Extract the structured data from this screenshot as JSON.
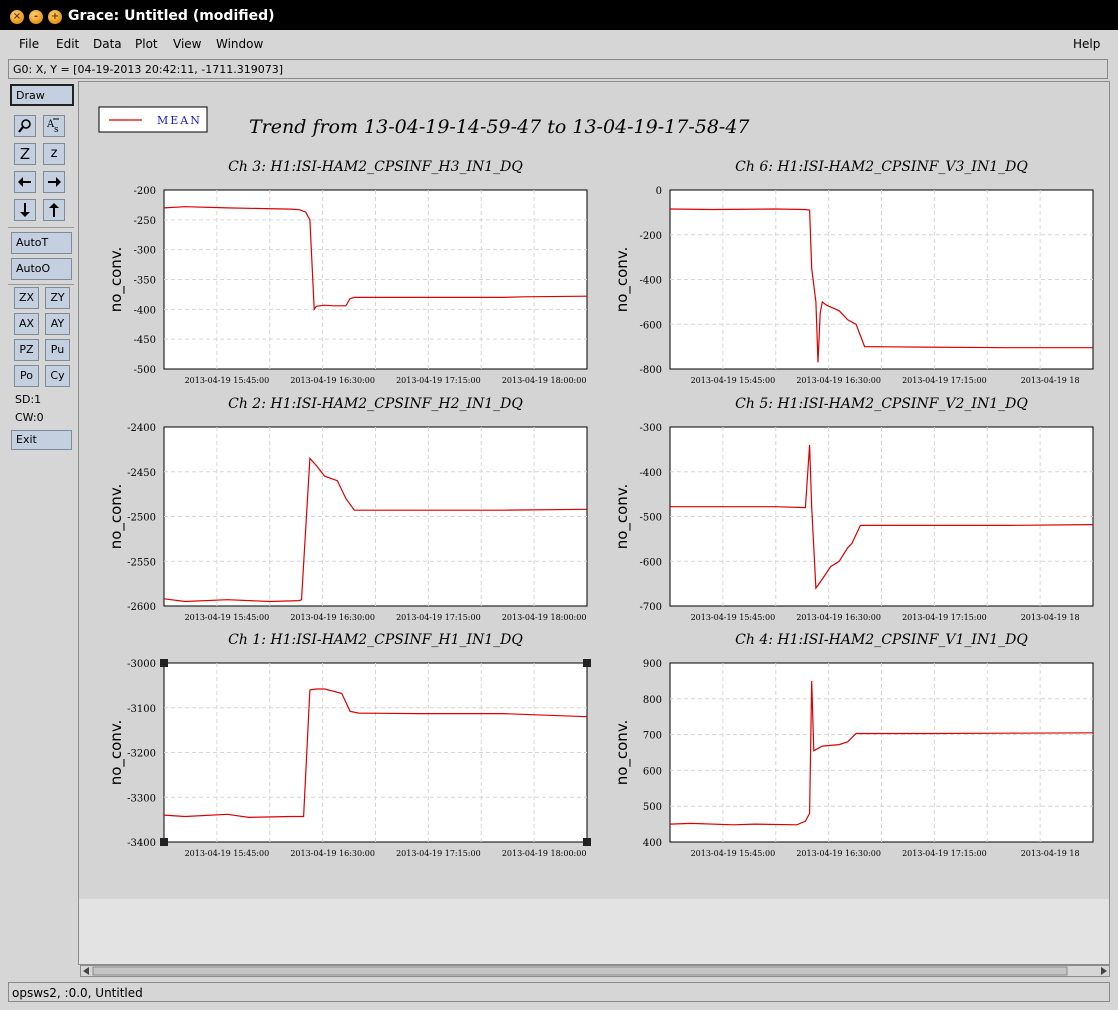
{
  "window": {
    "title": "Grace: Untitled (modified)",
    "buttons": [
      "close-icon",
      "minimize-icon",
      "maximize-icon"
    ]
  },
  "menubar": {
    "items": [
      "File",
      "Edit",
      "Data",
      "Plot",
      "View",
      "Window"
    ],
    "help": "Help"
  },
  "locator": "G0: X, Y = [04-19-2013 20:42:11, -1711.319073]",
  "toolbar": {
    "draw": "Draw",
    "icons": [
      "zoom-icon",
      "autoscale-text-icon",
      "zoom-in-icon",
      "zoom-out-icon",
      "left-arrow-icon",
      "right-arrow-icon",
      "down-arrow-icon",
      "up-arrow-icon"
    ],
    "zoom_in_label": "Z",
    "zoom_out_label": "z",
    "autoT": "AutoT",
    "autoO": "AutoO",
    "grid": [
      "ZX",
      "ZY",
      "AX",
      "AY",
      "PZ",
      "Pu",
      "Po",
      "Cy"
    ],
    "sd": "SD:1",
    "cw": "CW:0",
    "exit": "Exit"
  },
  "status": "opsws2, :0.0, Untitled",
  "chart_data": {
    "title": "Trend from 13-04-19-14-59-47 to 13-04-19-17-58-47",
    "legend": {
      "entries": [
        "MEAN"
      ],
      "placement": "top-left",
      "color": "#dd0000"
    },
    "line_color": "#dd0000",
    "grid": true,
    "panels": [
      {
        "title": "Ch 3: H1:ISI-HAM2_CPSINF_H3_IN1_DQ",
        "type": "line",
        "ylabel": "no_conv.",
        "ylim": [
          -500,
          -200
        ],
        "yticks": [
          -200,
          -250,
          -300,
          -350,
          -400,
          -450,
          -500
        ],
        "xticks": [
          "2013-04-19 15:45:00",
          "2013-04-19 16:30:00",
          "2013-04-19 17:15:00",
          "2013-04-19 18:00:00"
        ],
        "series": [
          {
            "x": [
              0,
              0.05,
              0.15,
              0.3,
              0.32,
              0.335,
              0.345,
              0.355,
              0.36,
              0.38,
              0.4,
              0.43,
              0.44,
              0.45,
              0.6,
              0.8,
              0.85,
              1.0
            ],
            "y": [
              -230,
              -228,
              -230,
              -232,
              -233,
              -237,
              -250,
              -400,
              -395,
              -393,
              -394,
              -394,
              -382,
              -380,
              -380,
              -380,
              -379,
              -378
            ]
          }
        ]
      },
      {
        "title": "Ch 6: H1:ISI-HAM2_CPSINF_V3_IN1_DQ",
        "type": "line",
        "ylabel": "no_conv.",
        "ylim": [
          -800,
          0
        ],
        "yticks": [
          0,
          -200,
          -400,
          -600,
          -800
        ],
        "xticks": [
          "2013-04-19 15:45:00",
          "2013-04-19 16:30:00",
          "2013-04-19 17:15:00",
          "2013-04-19 18"
        ],
        "series": [
          {
            "x": [
              0,
              0.1,
              0.25,
              0.32,
              0.33,
              0.335,
              0.345,
              0.35,
              0.355,
              0.36,
              0.37,
              0.4,
              0.42,
              0.44,
              0.46,
              0.6,
              0.8,
              1.0
            ],
            "y": [
              -85,
              -87,
              -85,
              -87,
              -90,
              -350,
              -500,
              -770,
              -550,
              -500,
              -515,
              -540,
              -580,
              -600,
              -700,
              -702,
              -705,
              -705
            ]
          }
        ]
      },
      {
        "title": "Ch 2: H1:ISI-HAM2_CPSINF_H2_IN1_DQ",
        "type": "line",
        "ylabel": "no_conv.",
        "ylim": [
          -2600,
          -2400
        ],
        "yticks": [
          -2400,
          -2450,
          -2500,
          -2550,
          -2600
        ],
        "xticks": [
          "2013-04-19 15:45:00",
          "2013-04-19 16:30:00",
          "2013-04-19 17:15:00",
          "2013-04-19 18:00:00"
        ],
        "series": [
          {
            "x": [
              0,
              0.05,
              0.15,
              0.25,
              0.32,
              0.325,
              0.345,
              0.36,
              0.38,
              0.41,
              0.43,
              0.45,
              0.6,
              0.8,
              1.0
            ],
            "y": [
              -2592,
              -2595,
              -2593,
              -2595,
              -2594,
              -2593,
              -2435,
              -2443,
              -2455,
              -2460,
              -2480,
              -2493,
              -2493,
              -2493,
              -2492
            ]
          }
        ]
      },
      {
        "title": "Ch 5: H1:ISI-HAM2_CPSINF_V2_IN1_DQ",
        "type": "line",
        "ylabel": "no_conv.",
        "ylim": [
          -700,
          -300
        ],
        "yticks": [
          -300,
          -400,
          -500,
          -600,
          -700
        ],
        "xticks": [
          "2013-04-19 15:45:00",
          "2013-04-19 16:30:00",
          "2013-04-19 17:15:00",
          "2013-04-19 18"
        ],
        "series": [
          {
            "x": [
              0,
              0.1,
              0.25,
              0.32,
              0.33,
              0.335,
              0.345,
              0.36,
              0.38,
              0.4,
              0.42,
              0.43,
              0.45,
              0.6,
              0.8,
              1.0
            ],
            "y": [
              -478,
              -478,
              -478,
              -480,
              -340,
              -480,
              -660,
              -640,
              -612,
              -600,
              -570,
              -560,
              -520,
              -520,
              -520,
              -518
            ]
          }
        ]
      },
      {
        "title": "Ch 1: H1:ISI-HAM2_CPSINF_H1_IN1_DQ",
        "type": "line",
        "ylabel": "no_conv.",
        "ylim": [
          -3400,
          -3000
        ],
        "yticks": [
          -3000,
          -3100,
          -3200,
          -3300,
          -3400
        ],
        "xticks": [
          "2013-04-19 15:45:00",
          "2013-04-19 16:30:00",
          "2013-04-19 17:15:00",
          "2013-04-19 18:00:00"
        ],
        "series": [
          {
            "x": [
              0,
              0.05,
              0.15,
              0.2,
              0.3,
              0.33,
              0.345,
              0.36,
              0.38,
              0.42,
              0.44,
              0.46,
              0.6,
              0.8,
              1.0
            ],
            "y": [
              -3340,
              -3343,
              -3338,
              -3345,
              -3343,
              -3343,
              -3060,
              -3058,
              -3058,
              -3068,
              -3108,
              -3112,
              -3113,
              -3113,
              -3120
            ]
          }
        ]
      },
      {
        "title": "Ch 4: H1:ISI-HAM2_CPSINF_V1_IN1_DQ",
        "type": "line",
        "ylabel": "no_conv.",
        "ylim": [
          400,
          900
        ],
        "yticks": [
          900,
          800,
          700,
          600,
          500,
          400
        ],
        "xticks": [
          "2013-04-19 15:45:00",
          "2013-04-19 16:30:00",
          "2013-04-19 17:15:00",
          "2013-04-19 18"
        ],
        "series": [
          {
            "x": [
              0,
              0.05,
              0.15,
              0.2,
              0.3,
              0.32,
              0.33,
              0.335,
              0.34,
              0.36,
              0.4,
              0.42,
              0.44,
              0.6,
              0.8,
              1.0
            ],
            "y": [
              450,
              452,
              448,
              450,
              448,
              458,
              480,
              850,
              655,
              668,
              672,
              680,
              703,
              703,
              704,
              705
            ]
          }
        ]
      }
    ]
  }
}
